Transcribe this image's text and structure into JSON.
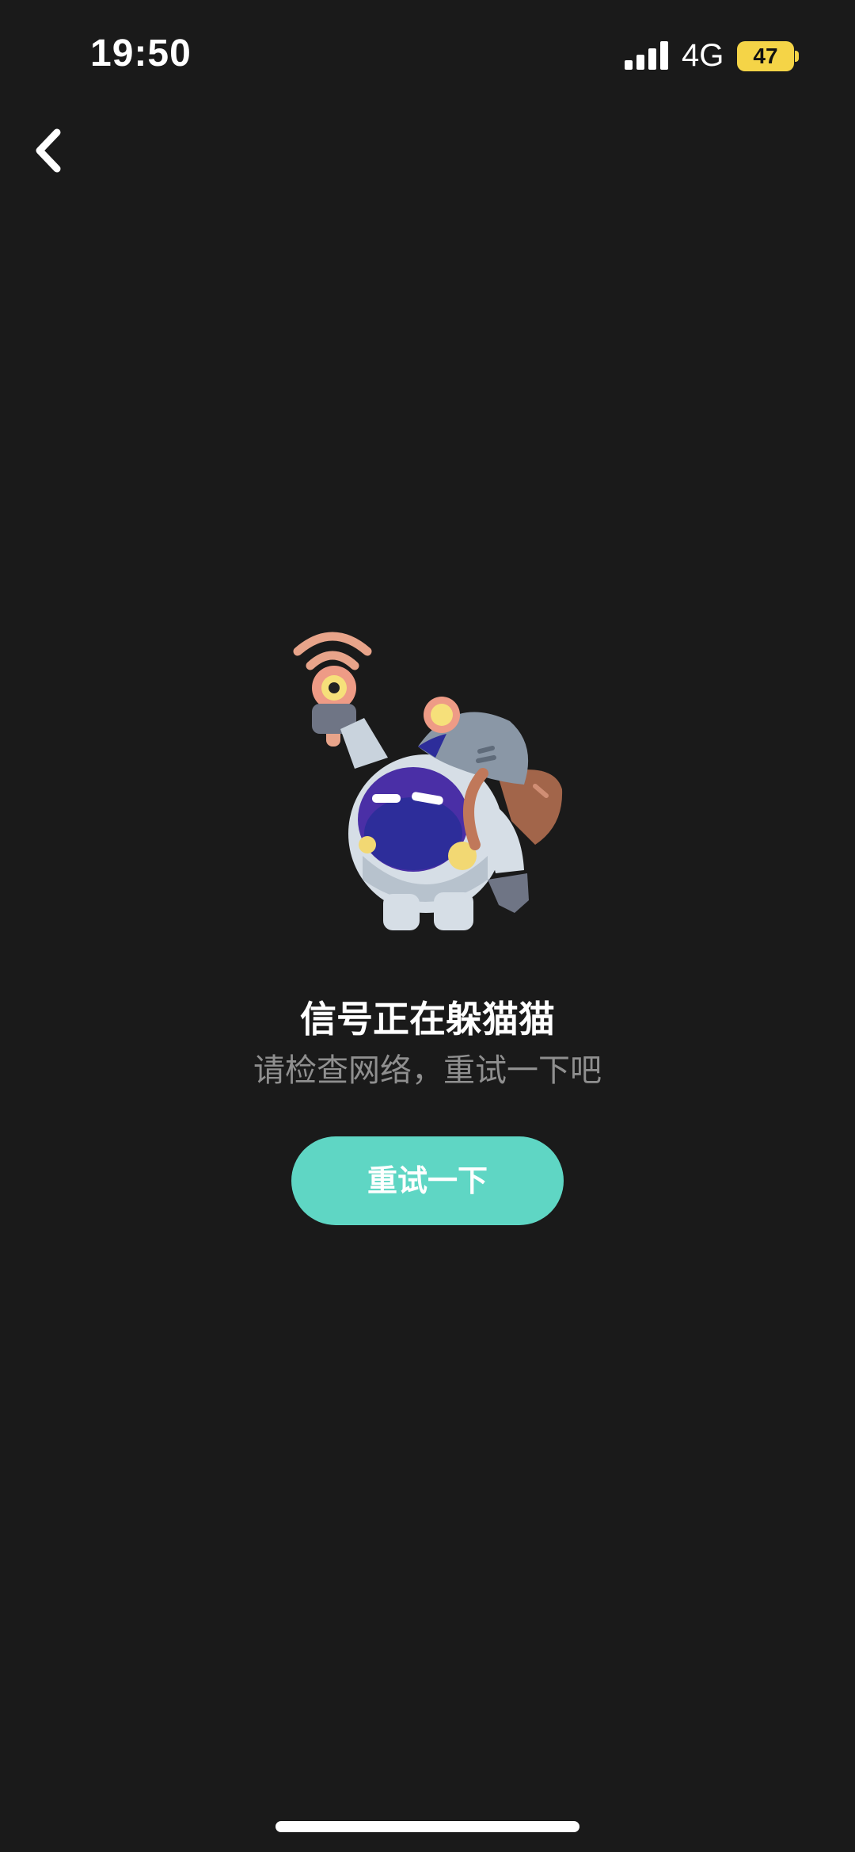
{
  "status_bar": {
    "time": "19:50",
    "network": "4G",
    "battery": "47",
    "battery_color": "#f5d447"
  },
  "nav": {
    "back_icon": "chevron-left-icon"
  },
  "illustration": {
    "icon": "astronaut-wifi-illustration"
  },
  "error": {
    "title": "信号正在躲猫猫",
    "subtitle": "请检查网络，重试一下吧"
  },
  "actions": {
    "retry_label": "重试一下",
    "retry_color": "#5fd6c4"
  }
}
